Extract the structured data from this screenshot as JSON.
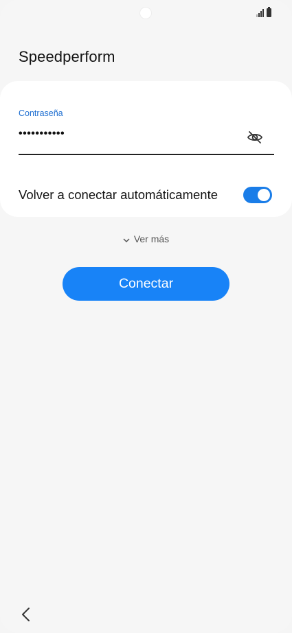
{
  "header": {
    "network_name": "Speedperform"
  },
  "password_field": {
    "label": "Contraseña",
    "value": "•••••••••••",
    "visibility_icon": "eye-off-icon"
  },
  "auto_reconnect": {
    "label": "Volver a conectar automáticamente",
    "enabled": true
  },
  "see_more": {
    "label": "Ver más",
    "icon": "chevron-down-icon"
  },
  "connect_button": {
    "label": "Conectar"
  },
  "navigation": {
    "back_icon": "chevron-left-icon"
  },
  "colors": {
    "accent": "#1883f7",
    "label_blue": "#1f6fd1",
    "toggle_on": "#1a7de8",
    "background": "#f6f6f6",
    "card": "#ffffff"
  }
}
